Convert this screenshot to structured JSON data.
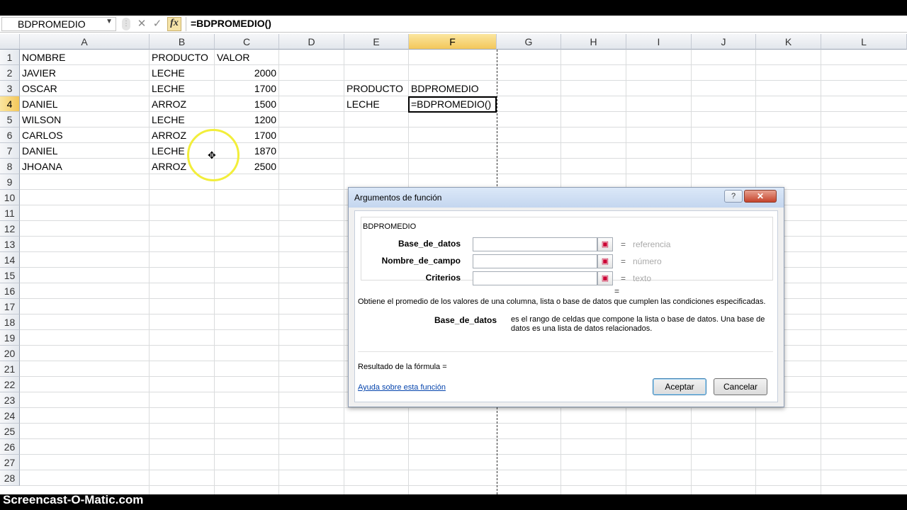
{
  "formula_bar": {
    "name_box": "BDPROMEDIO",
    "cancel_glyph": "✕",
    "enter_glyph": "✓",
    "fx_label": "fx",
    "formula": "=BDPROMEDIO()"
  },
  "grid": {
    "columns": [
      "A",
      "B",
      "C",
      "D",
      "E",
      "F",
      "G",
      "H",
      "I",
      "J",
      "K",
      "L"
    ],
    "selected_column": "F",
    "rows": [
      "1",
      "2",
      "3",
      "4",
      "5",
      "6",
      "7",
      "8",
      "9",
      "10",
      "11",
      "12",
      "13",
      "14",
      "15",
      "16",
      "17",
      "18",
      "19",
      "20",
      "21",
      "22",
      "23",
      "24",
      "25",
      "26",
      "27",
      "28"
    ],
    "selected_row": "4",
    "table_headers": {
      "a1": "NOMBRE",
      "b1": "PRODUCTO",
      "c1": "VALOR"
    },
    "table_rows": [
      {
        "nombre": "JAVIER",
        "producto": "LECHE",
        "valor": "2000"
      },
      {
        "nombre": "OSCAR",
        "producto": "LECHE",
        "valor": "1700"
      },
      {
        "nombre": "DANIEL",
        "producto": "ARROZ",
        "valor": "1500"
      },
      {
        "nombre": "WILSON",
        "producto": "LECHE",
        "valor": "1200"
      },
      {
        "nombre": "CARLOS",
        "producto": "ARROZ",
        "valor": "1700"
      },
      {
        "nombre": "DANIEL",
        "producto": "LECHE",
        "valor": "1870"
      },
      {
        "nombre": "JHOANA",
        "producto": "ARROZ",
        "valor": "2500"
      }
    ],
    "criteria": {
      "e3": "PRODUCTO",
      "f3": "BDPROMEDIO",
      "e4": "LECHE",
      "f4": "=BDPROMEDIO()"
    }
  },
  "dialog": {
    "title": "Argumentos de función",
    "help_glyph": "?",
    "close_glyph": "✕",
    "function_name": "BDPROMEDIO",
    "args": [
      {
        "label": "Base_de_datos",
        "value": "",
        "eq": "=",
        "type": "referencia"
      },
      {
        "label": "Nombre_de_campo",
        "value": "",
        "eq": "=",
        "type": "número"
      },
      {
        "label": "Criterios",
        "value": "",
        "eq": "=",
        "type": "texto"
      }
    ],
    "result_eq": "=",
    "description": "Obtiene el promedio de los valores de una columna, lista o base de datos que cumplen las condiciones especificadas.",
    "arg_desc_name": "Base_de_datos",
    "arg_desc_text": "es el rango de celdas que compone la lista o base de datos. Una base de datos es una lista de datos relacionados.",
    "result_label": "Resultado de la fórmula =",
    "help_link": "Ayuda sobre esta función",
    "ok_label": "Aceptar",
    "cancel_label": "Cancelar"
  },
  "watermark": "Screencast-O-Matic.com",
  "colors": {
    "selected_header": "#f3c75a",
    "cursor_highlight": "#f2ee3b",
    "link": "#0645ad"
  }
}
